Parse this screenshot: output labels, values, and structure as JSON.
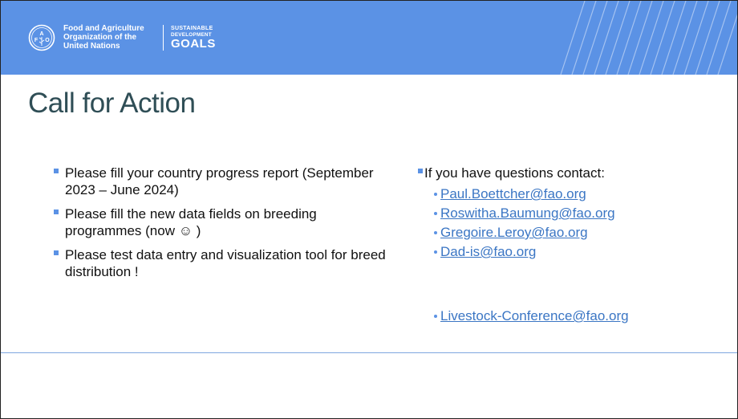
{
  "header": {
    "org_lines": [
      "Food and Agriculture",
      "Organization of the",
      "United Nations"
    ],
    "sdg_line1": "SUSTAINABLE",
    "sdg_line2": "DEVELOPMENT",
    "sdg_line3": "GOALS",
    "fao_logo_icon": "fao-emblem-icon",
    "brand_color": "#5b92e5"
  },
  "slide": {
    "title": "Call for Action",
    "left_bullets": [
      "Please fill your country progress report (September 2023 – June 2024)",
      "Please fill the new data fields on breeding programmes (now ☺ )",
      "Please test data entry and visualization tool for breed distribution !"
    ],
    "right_heading": "If you have questions contact:",
    "contacts": [
      "Paul.Boettcher@fao.org",
      "Roswitha.Baumung@fao.org",
      "Gregoire.Leroy@fao.org",
      "Dad-is@fao.org",
      "Livestock-Conference@fao.org"
    ],
    "link_color": "#3b76c4",
    "title_color": "#2f4e56"
  }
}
